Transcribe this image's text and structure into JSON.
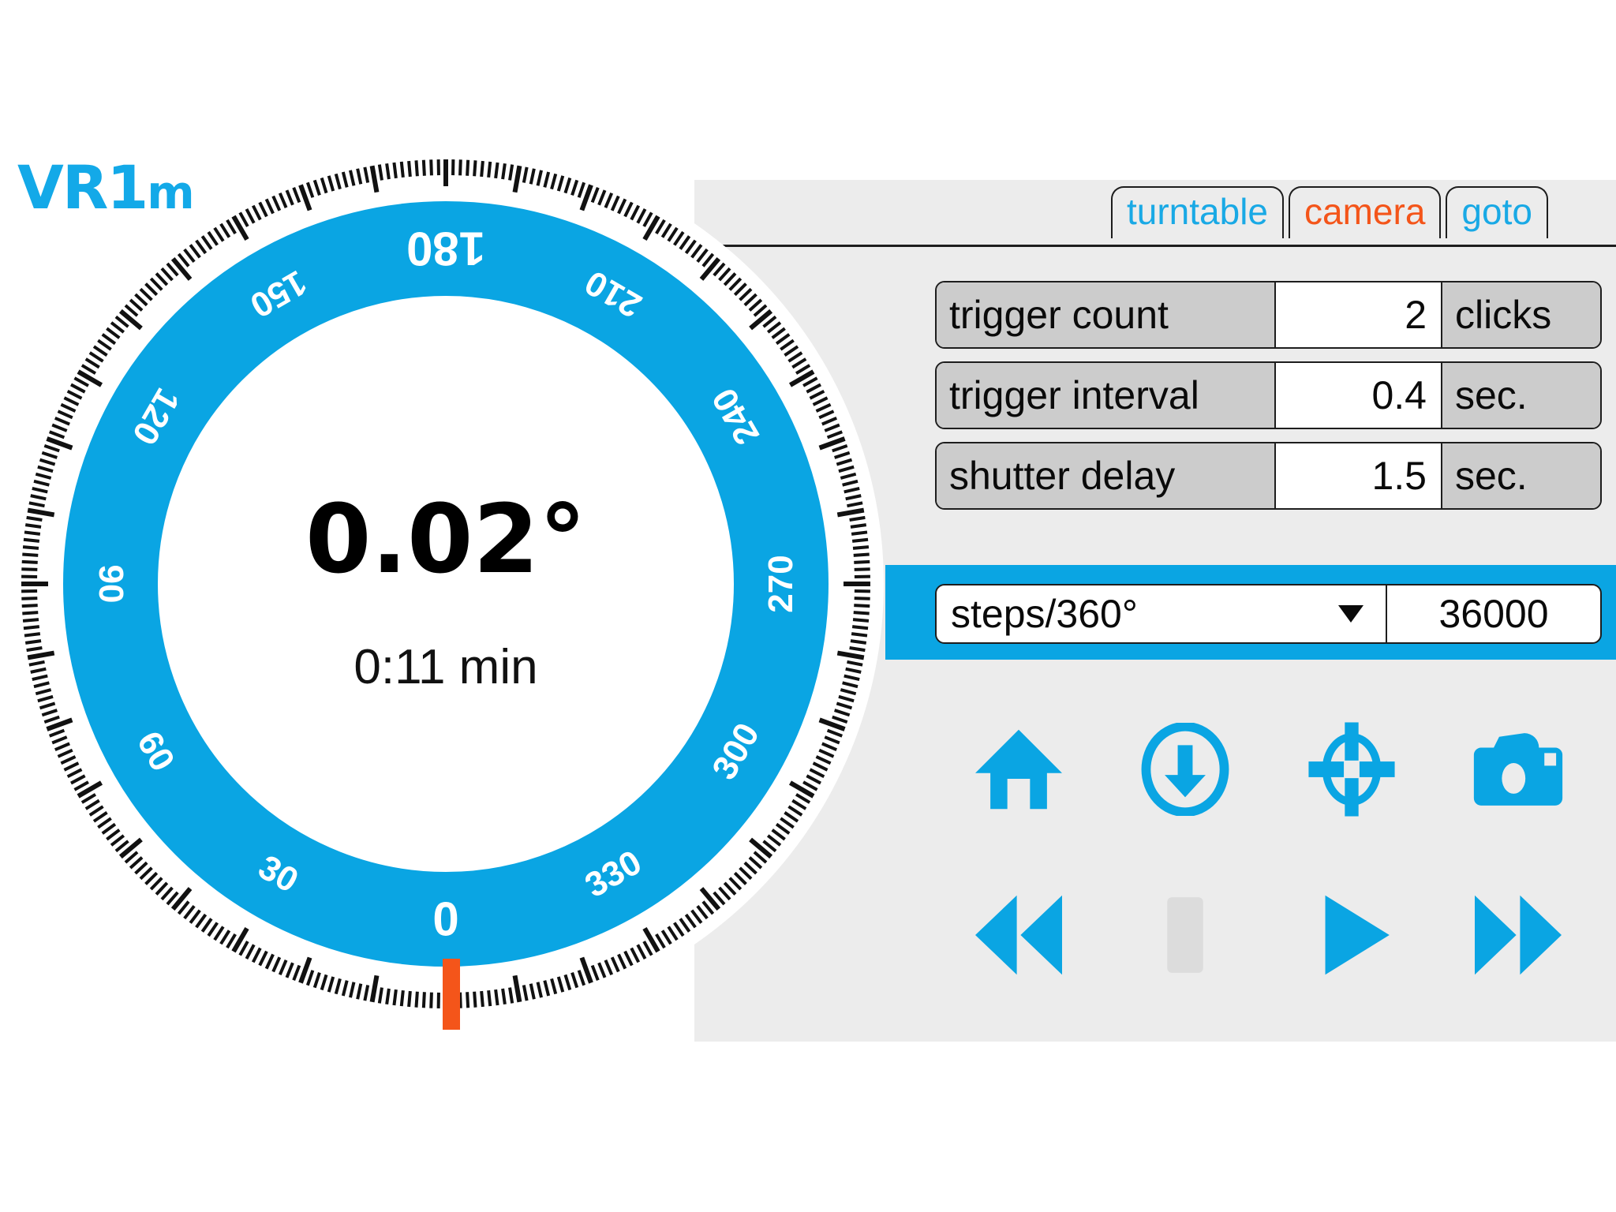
{
  "app": {
    "logo_main": "VR1",
    "logo_sub": "m",
    "accent_blue": "#0aa5e3",
    "accent_orange": "#f4551a",
    "panel_bg": "#ececec",
    "label_bg": "#cccccc"
  },
  "tabs": [
    {
      "label": "turntable",
      "active": false
    },
    {
      "label": "camera",
      "active": true
    },
    {
      "label": "goto",
      "active": false
    }
  ],
  "params": [
    {
      "label": "trigger count",
      "value": "2",
      "unit": "clicks"
    },
    {
      "label": "trigger interval",
      "value": "0.4",
      "unit": "sec."
    },
    {
      "label": "shutter delay",
      "value": "1.5",
      "unit": "sec."
    }
  ],
  "steps": {
    "selected": "steps/360°",
    "value": "36000",
    "caret": "chevron-down-icon",
    "options": [
      "steps/360°"
    ]
  },
  "actions_row1": [
    {
      "name": "home-icon",
      "label": "home"
    },
    {
      "name": "download-icon",
      "label": "download"
    },
    {
      "name": "target-icon",
      "label": "target"
    },
    {
      "name": "camera-icon",
      "label": "camera"
    }
  ],
  "actions_row2": [
    {
      "name": "rewind-icon",
      "label": "rewind",
      "enabled": true
    },
    {
      "name": "stop-icon",
      "label": "stop",
      "enabled": false
    },
    {
      "name": "play-icon",
      "label": "play",
      "enabled": true
    },
    {
      "name": "fast-forward-icon",
      "label": "fast forward",
      "enabled": true
    }
  ],
  "dial": {
    "angle_readout": "0.02°",
    "time_readout": "0:11 min",
    "marker_position_deg": 0,
    "tick_major_step": 10,
    "tick_minor_step": 1,
    "labels": [
      {
        "text": "0",
        "deg": 0
      },
      {
        "text": "30",
        "deg": 30
      },
      {
        "text": "60",
        "deg": 60
      },
      {
        "text": "90",
        "deg": 90
      },
      {
        "text": "120",
        "deg": 120
      },
      {
        "text": "150",
        "deg": 150
      },
      {
        "text": "180",
        "deg": 180
      },
      {
        "text": "210",
        "deg": 210
      },
      {
        "text": "240",
        "deg": 240
      },
      {
        "text": "270",
        "deg": 270
      },
      {
        "text": "300",
        "deg": 300
      },
      {
        "text": "330",
        "deg": 330
      }
    ]
  }
}
